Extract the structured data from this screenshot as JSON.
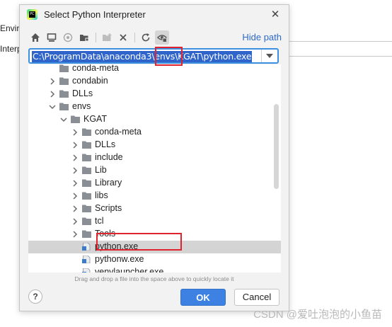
{
  "background": {
    "label_env": "Envir",
    "label_interp": "Interp"
  },
  "dialog": {
    "title": "Select Python Interpreter",
    "app_icon_text": "PC",
    "close_symbol": "✕",
    "hide_path_label": "Hide path",
    "path_value": "C:\\ProgramData\\anaconda3\\envs\\KGAT\\python.exe",
    "drag_hint": "Drag and drop a file into the space above to quickly locate it",
    "ok_label": "OK",
    "cancel_label": "Cancel",
    "help_symbol": "?"
  },
  "toolbar_icons": [
    "home-icon",
    "desktop-icon",
    "project-icon",
    "module-icon",
    "new-folder-icon",
    "delete-icon",
    "refresh-icon",
    "show-hidden-icon"
  ],
  "tree": {
    "rows": [
      {
        "label": "conda-meta",
        "type": "folder",
        "expander": "none",
        "depth": 1
      },
      {
        "label": "condabin",
        "type": "folder",
        "expander": "collapsed",
        "depth": 1
      },
      {
        "label": "DLLs",
        "type": "folder",
        "expander": "collapsed",
        "depth": 1
      },
      {
        "label": "envs",
        "type": "folder",
        "expander": "expanded",
        "depth": 1
      },
      {
        "label": "KGAT",
        "type": "folder",
        "expander": "expanded",
        "depth": 2
      },
      {
        "label": "conda-meta",
        "type": "folder",
        "expander": "collapsed",
        "depth": 3
      },
      {
        "label": "DLLs",
        "type": "folder",
        "expander": "collapsed",
        "depth": 3
      },
      {
        "label": "include",
        "type": "folder",
        "expander": "collapsed",
        "depth": 3
      },
      {
        "label": "Lib",
        "type": "folder",
        "expander": "collapsed",
        "depth": 3
      },
      {
        "label": "Library",
        "type": "folder",
        "expander": "collapsed",
        "depth": 3
      },
      {
        "label": "libs",
        "type": "folder",
        "expander": "collapsed",
        "depth": 3
      },
      {
        "label": "Scripts",
        "type": "folder",
        "expander": "collapsed",
        "depth": 3
      },
      {
        "label": "tcl",
        "type": "folder",
        "expander": "collapsed",
        "depth": 3
      },
      {
        "label": "Tools",
        "type": "folder",
        "expander": "collapsed",
        "depth": 3
      },
      {
        "label": "python.exe",
        "type": "file",
        "expander": "none",
        "depth": 3,
        "selected": true
      },
      {
        "label": "pythonw.exe",
        "type": "file",
        "expander": "none",
        "depth": 3
      },
      {
        "label": "venvlauncher.exe",
        "type": "file",
        "expander": "none",
        "depth": 3
      }
    ]
  },
  "watermark": "CSDN @爱吐泡泡的小鱼苗",
  "colors": {
    "accent": "#3d82e3",
    "selection_text_bg": "#2f65ca",
    "annotation_red": "#e0242f",
    "folder": "#8a8f96"
  }
}
